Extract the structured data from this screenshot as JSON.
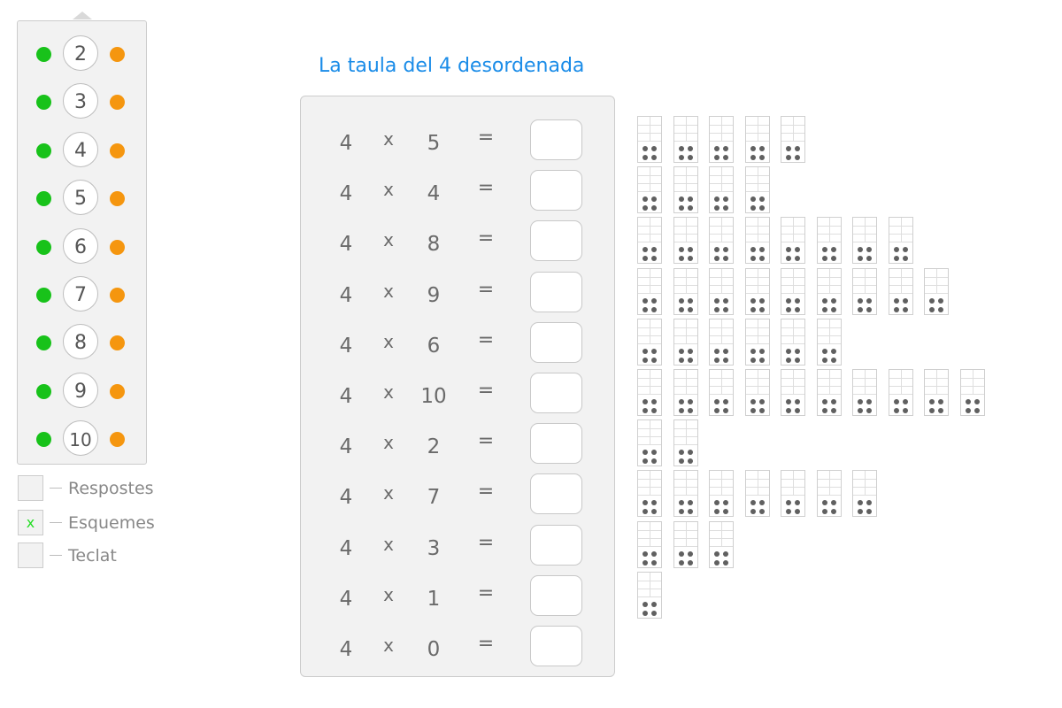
{
  "colors": {
    "accent": "#1a8ce8",
    "green_dot": "#18c21a",
    "orange_dot": "#f5960f",
    "check_mark": "#22dd22"
  },
  "tables_selector": {
    "numbers": [
      "2",
      "3",
      "4",
      "5",
      "6",
      "7",
      "8",
      "9",
      "10"
    ]
  },
  "options": [
    {
      "label": "Respostes",
      "mark": ""
    },
    {
      "label": "Esquemes",
      "mark": "x"
    },
    {
      "label": "Teclat",
      "mark": ""
    }
  ],
  "title": "La taula del 4 desordenada",
  "exercise": {
    "operator": "x",
    "equals": "=",
    "rows": [
      {
        "a": "4",
        "b": "5",
        "answer": ""
      },
      {
        "a": "4",
        "b": "4",
        "answer": ""
      },
      {
        "a": "4",
        "b": "8",
        "answer": ""
      },
      {
        "a": "4",
        "b": "9",
        "answer": ""
      },
      {
        "a": "4",
        "b": "6",
        "answer": ""
      },
      {
        "a": "4",
        "b": "10",
        "answer": ""
      },
      {
        "a": "4",
        "b": "2",
        "answer": ""
      },
      {
        "a": "4",
        "b": "7",
        "answer": ""
      },
      {
        "a": "4",
        "b": "3",
        "answer": ""
      },
      {
        "a": "4",
        "b": "1",
        "answer": ""
      },
      {
        "a": "4",
        "b": "0",
        "answer": ""
      }
    ]
  },
  "schemes": {
    "dots_per_group": 4,
    "group_counts": [
      5,
      4,
      8,
      9,
      6,
      10,
      2,
      7,
      3,
      1,
      0
    ]
  }
}
